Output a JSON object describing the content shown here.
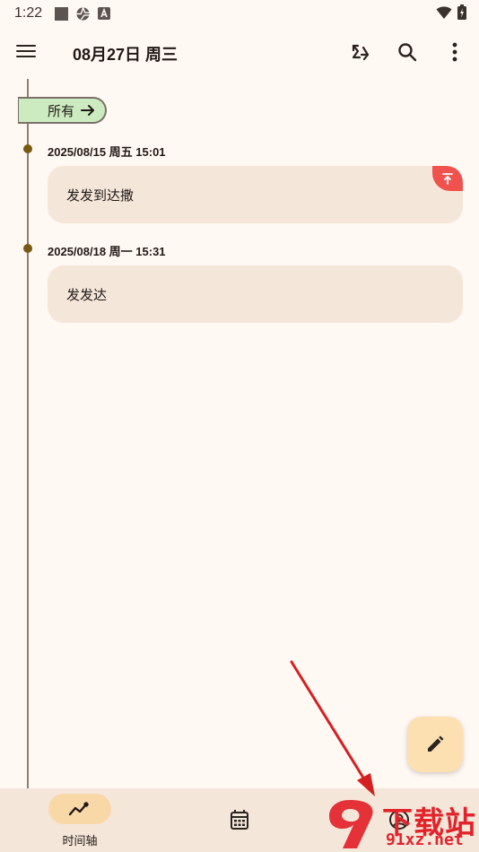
{
  "status_bar": {
    "time": "1:22",
    "icons": [
      "square-notification-icon",
      "aperture-icon",
      "text-a-icon",
      "wifi-icon",
      "battery-charging-icon"
    ]
  },
  "app_bar": {
    "title": "08月27日 周三",
    "icons": [
      "menu-icon",
      "sync-icon",
      "search-icon",
      "more-vert-icon"
    ]
  },
  "filter": {
    "label": "所有"
  },
  "entries": [
    {
      "date": "2025/08/15 周五 15:01",
      "text": "发发到达撒",
      "pinned": true
    },
    {
      "date": "2025/08/18 周一 15:31",
      "text": "发发达",
      "pinned": false
    }
  ],
  "fab": {
    "icon": "edit-icon"
  },
  "bottom_nav": {
    "items": [
      {
        "label": "时间轴",
        "icon": "timeline-icon",
        "selected": true
      },
      {
        "label": "",
        "icon": "calendar-icon",
        "selected": false
      },
      {
        "label": "",
        "icon": "account-icon",
        "selected": false
      }
    ]
  },
  "watermark": {
    "logo_text": "9",
    "text1": "下载站",
    "text2": "91xz.net"
  },
  "colors": {
    "background": "#fff8f3",
    "card": "#f5e6da",
    "chip": "#cdebc1",
    "fab": "#fde0b2",
    "nav_pill": "#f9d8a8",
    "pin": "#f0524d",
    "annotation_arrow": "#d42020"
  }
}
